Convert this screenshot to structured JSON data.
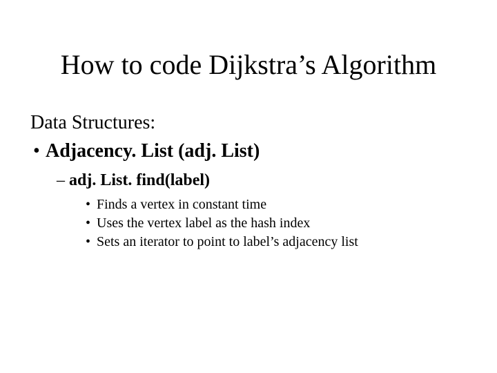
{
  "title": "How to code Dijkstra’s Algorithm",
  "intro": "Data Structures:",
  "lvl1": {
    "bullet": "•",
    "text": "Adjacency. List (adj. List)"
  },
  "lvl2": {
    "dash": "–",
    "text": "adj. List. find(label)"
  },
  "lvl3": [
    {
      "bullet": "•",
      "text": "Finds a vertex in constant time"
    },
    {
      "bullet": "•",
      "text": "Uses the vertex label as the hash index"
    },
    {
      "bullet": "•",
      "text": "Sets an iterator to point to label’s adjacency list"
    }
  ]
}
